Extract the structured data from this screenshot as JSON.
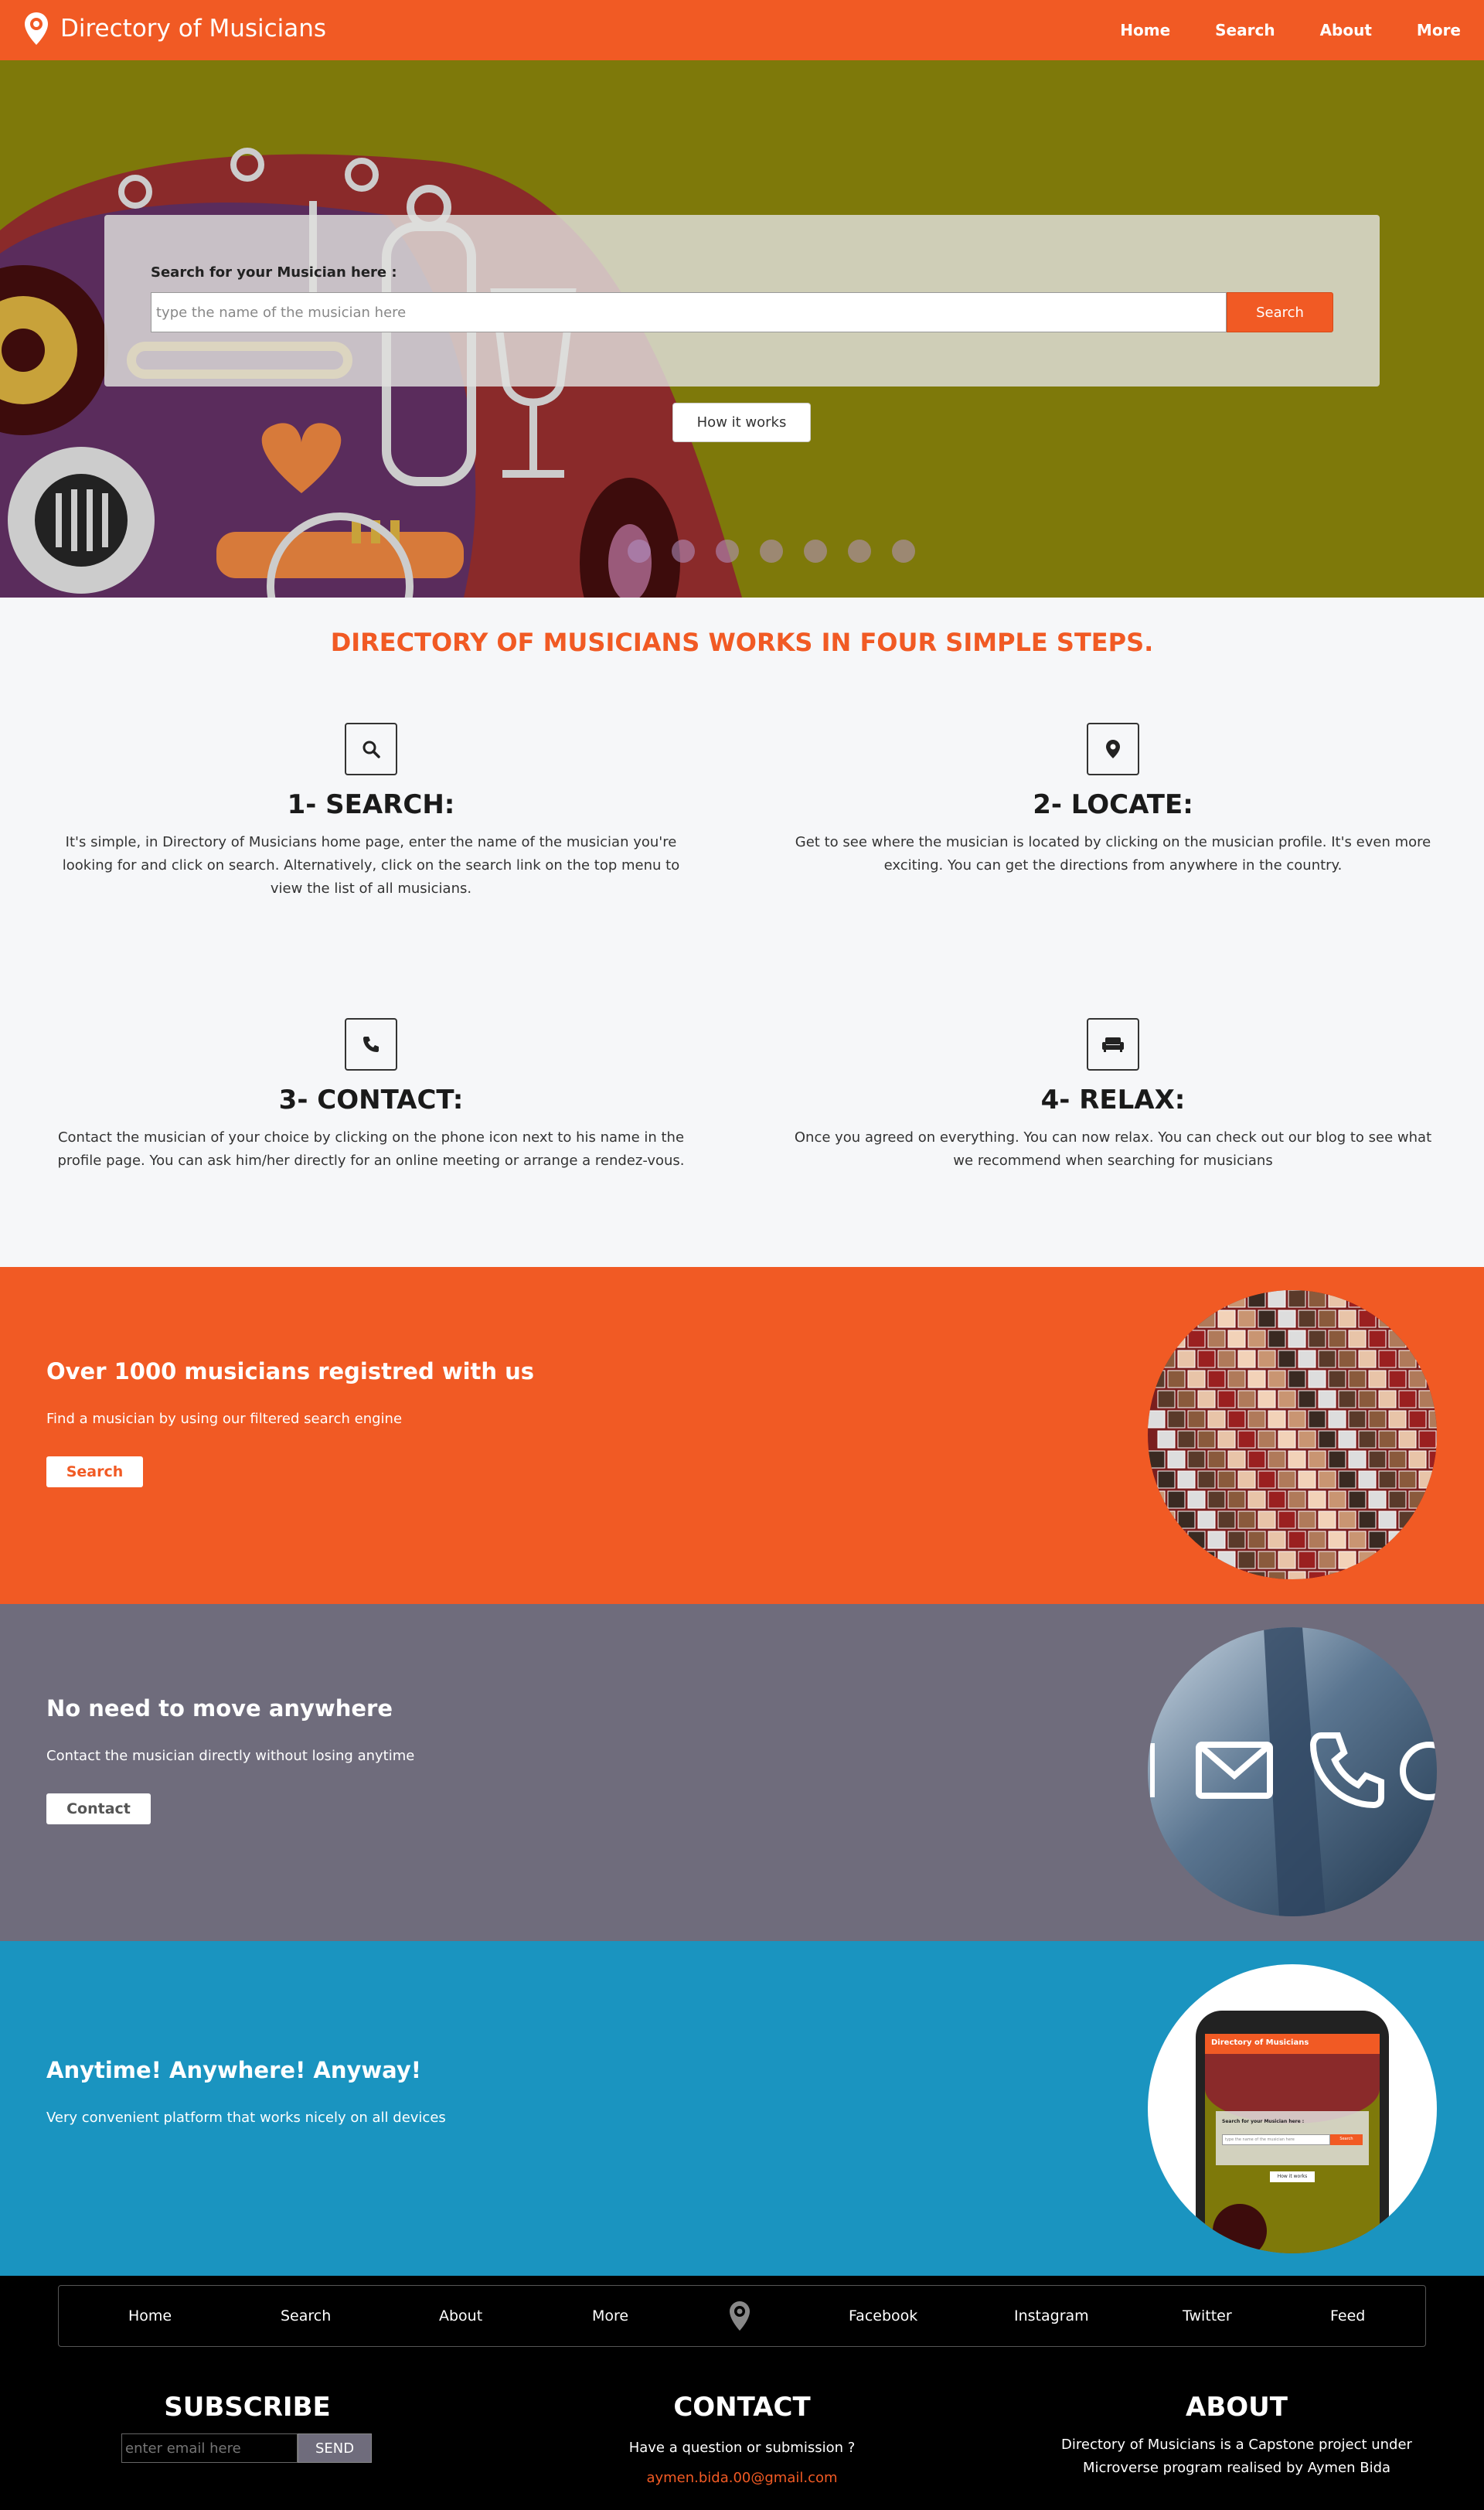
{
  "navbar": {
    "brand": "Directory of Musicians",
    "links": [
      "Home",
      "Search",
      "About",
      "More"
    ]
  },
  "hero": {
    "search_label": "Search for your Musician here :",
    "search_placeholder": "type the name of the musician here",
    "search_button": "Search",
    "how_button": "How it works",
    "carousel_count": 7
  },
  "steps": {
    "title": "DIRECTORY OF MUSICIANS WORKS IN FOUR SIMPLE STEPS.",
    "items": [
      {
        "icon": "search-icon",
        "title": "1- SEARCH:",
        "text": "It's simple, in Directory of Musicians home page, enter the name of the musician you're looking for and click on search. Alternatively, click on the search link on the top menu to view the list of all musicians."
      },
      {
        "icon": "map-marker-icon",
        "title": "2- LOCATE:",
        "text": "Get to see where the musician is located by clicking on the musician profile. It's even more exciting. You can get the directions from anywhere in the country."
      },
      {
        "icon": "phone-icon",
        "title": "3- CONTACT:",
        "text": "Contact the musician of your choice by clicking on the phone icon next to his name in the profile page. You can ask him/her directly for an online meeting or arrange a rendez-vous."
      },
      {
        "icon": "couch-icon",
        "title": "4- RELAX:",
        "text": "Once you agreed on everything. You can now relax. You can check out our blog to see what we recommend when searching for musicians"
      }
    ]
  },
  "bands": [
    {
      "title": "Over 1000 musicians registred with us",
      "text": "Find a musician by using our filtered search engine",
      "button": "Search",
      "color": "#f15a24"
    },
    {
      "title": "No need to move anywhere",
      "text": "Contact the musician directly without losing anytime",
      "button": "Contact",
      "color": "#6f6c7c"
    },
    {
      "title": "Anytime! Anywhere! Anyway!",
      "text": "Very convenient platform that works nicely on all devices",
      "color": "#1a94c0"
    }
  ],
  "phone_mockup": {
    "brand": "Directory of Musicians",
    "label": "Search for your Musician here :",
    "placeholder": "type the name of the musician here",
    "button": "Search",
    "how": "How it works"
  },
  "footer": {
    "nav": [
      "Home",
      "Search",
      "About",
      "More",
      "Facebook",
      "Instagram",
      "Twitter",
      "Feed"
    ],
    "subscribe": {
      "title": "SUBSCRIBE",
      "placeholder": "enter email here",
      "button": "SEND"
    },
    "contact": {
      "title": "CONTACT",
      "text": "Have a question or submission ?",
      "email": "aymen.bida.00@gmail.com"
    },
    "about": {
      "title": "ABOUT",
      "text": "Directory of Musicians is a Capstone project under Microverse program realised by Aymen Bida"
    }
  },
  "colors": {
    "accent": "#f15a24",
    "gray_band": "#6f6c7c",
    "blue_band": "#1a94c0",
    "hero_bg": "#7e790a",
    "footer_bg": "#000000"
  }
}
